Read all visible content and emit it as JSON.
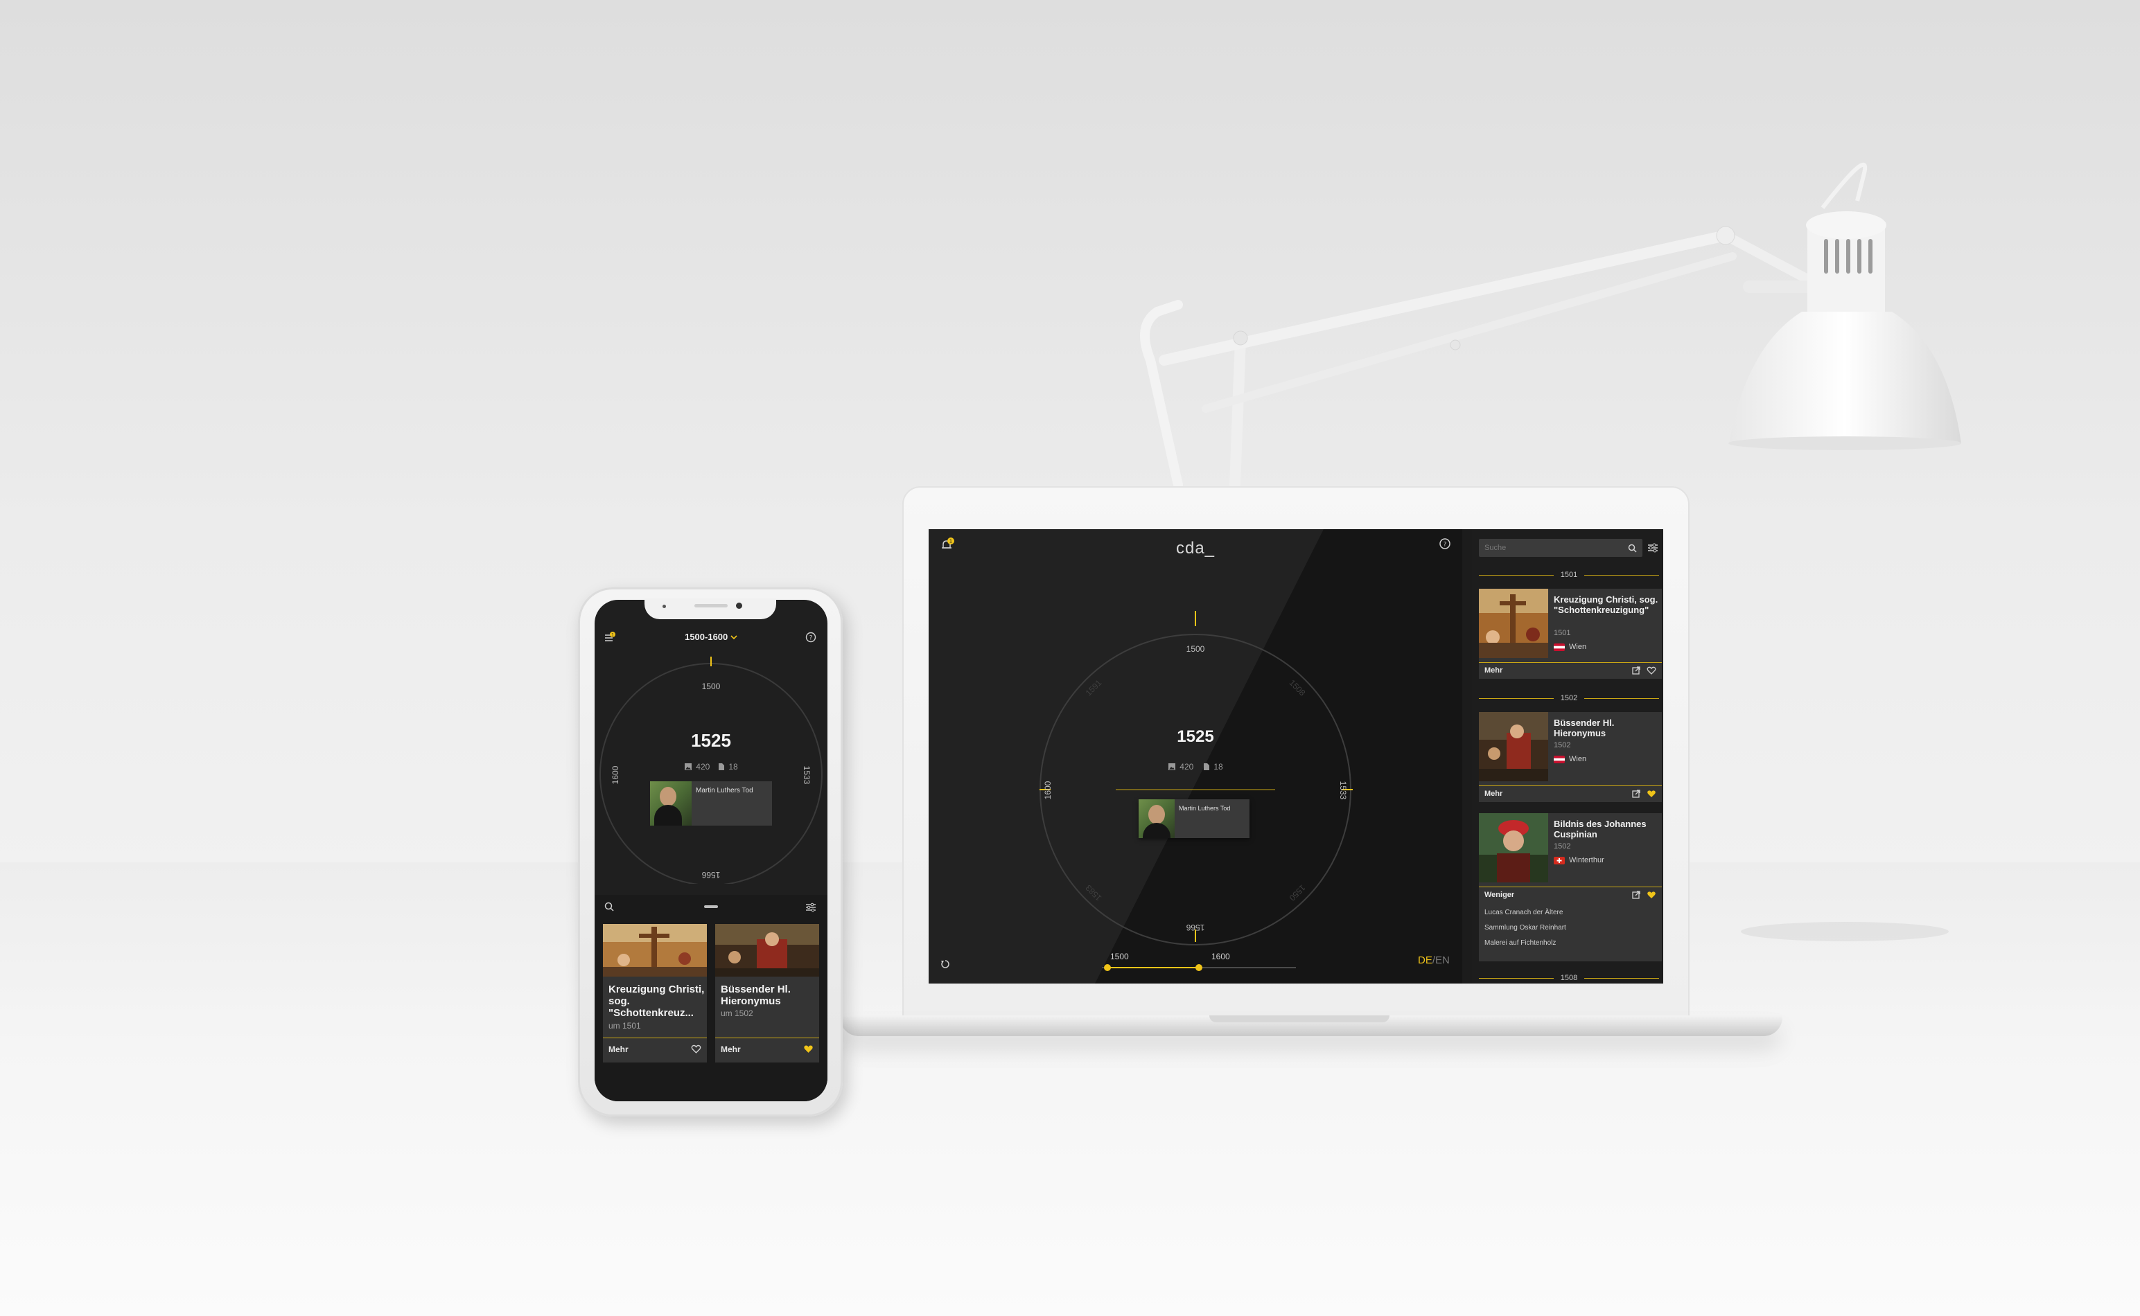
{
  "laptop": {
    "app": {
      "logo": "cda_",
      "notification_count": "1",
      "wheel": {
        "year": "1525",
        "images_count": "420",
        "documents_count": "18",
        "label_top": "1500",
        "label_right": "1533",
        "label_bottom": "1566",
        "label_left": "1600",
        "faint_labels": [
          "1508",
          "1550",
          "1583",
          "1591"
        ]
      },
      "event": {
        "title": "Martin Luthers Tod"
      },
      "range": {
        "start": "1500",
        "end": "1600",
        "start_value": 1500,
        "end_value": 1600,
        "min": 1500,
        "max": 1700
      },
      "language": {
        "active": "DE",
        "separator": "/",
        "inactive": "EN"
      }
    },
    "sidebar": {
      "search_placeholder": "Suche",
      "groups": [
        {
          "year": "1501",
          "items": [
            {
              "title": "Kreuzigung Christi, sog. \"Schottenkreuzigung\"",
              "year": "1501",
              "location": "Wien",
              "more": "Mehr",
              "favorite": false
            }
          ]
        },
        {
          "year": "1502",
          "items": [
            {
              "title": "Büssender Hl. Hieronymus",
              "year": "1502",
              "location": "Wien",
              "more": "Mehr",
              "favorite": true
            },
            {
              "title": "Bildnis des Johannes Cuspinian",
              "year": "1502",
              "location": "Winterthur",
              "more": "Weniger",
              "favorite": true,
              "details": [
                "Lucas Cranach der Ältere",
                "Sammlung Oskar Reinhart",
                "Malerei auf Fichtenholz"
              ]
            }
          ]
        },
        {
          "year": "1508",
          "items": []
        }
      ]
    }
  },
  "phone": {
    "range_label": "1500-1600",
    "notification_count": "1",
    "wheel": {
      "year": "1525",
      "images_count": "420",
      "documents_count": "18",
      "label_top": "1500",
      "label_right": "1533",
      "label_bottom": "1566",
      "label_left": "1600"
    },
    "event": {
      "title": "Martin Luthers Tod"
    },
    "cards": [
      {
        "title": "Kreuzigung Christi, sog. \"Schottenkreuz...",
        "year": "um 1501",
        "more": "Mehr",
        "favorite": false
      },
      {
        "title": "Büssender Hl. Hieronymus",
        "year": "um 1502",
        "more": "Mehr",
        "favorite": true
      }
    ]
  },
  "colors": {
    "accent": "#f0c419",
    "screen_bg": "#222222",
    "card_bg": "#343434",
    "flag_austria": "#c8102e",
    "flag_switzerland": "#d52b1e"
  }
}
